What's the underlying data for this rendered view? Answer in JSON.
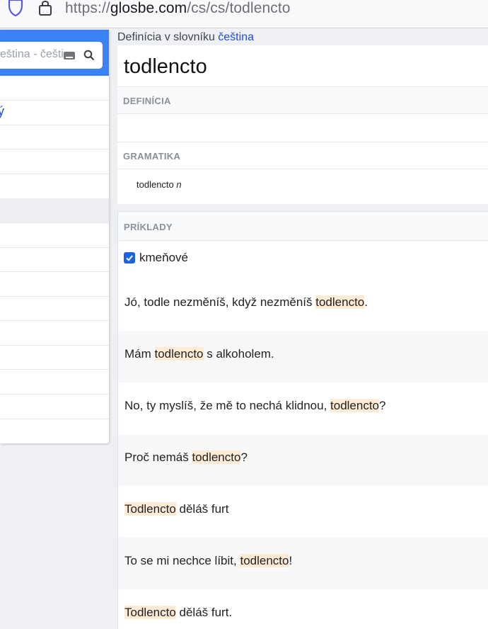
{
  "browser": {
    "url_prefix": "https://",
    "url_host": "glosbe.com",
    "url_path": "/cs/cs/todlencto"
  },
  "sidebar": {
    "search_placeholder": "eština - češti",
    "link_fragment": "ý"
  },
  "breadcrumb": {
    "prefix": "Definícia v slovníku ",
    "language": "čeština"
  },
  "entry": {
    "headword": "todlencto",
    "definition_header": "DEFINÍCIA",
    "grammar_header": "GRAMATIKA",
    "grammar_word": "todlencto",
    "grammar_tag": "n"
  },
  "examples": {
    "header": "PRÍKLADY",
    "stem_label": "kmeňové",
    "stem_checked": true,
    "items": [
      {
        "before": "Jó, todle nezměníš, když nezměníš ",
        "term": "todlencto",
        "after": "."
      },
      {
        "before": "Mám ",
        "term": "todlencto",
        "after": " s alkoholem."
      },
      {
        "before": "No, ty myslíš, že mě to nechá klidnou, ",
        "term": "todlencto",
        "after": "?"
      },
      {
        "before": "Proč nemáš ",
        "term": "todlencto",
        "after": "?"
      },
      {
        "before": "",
        "term": "Todlencto",
        "after": " děláš furt"
      },
      {
        "before": "To se mi nechce líbit, ",
        "term": "todlencto",
        "after": "!"
      },
      {
        "before": "",
        "term": "Todlencto",
        "after": " děláš furt."
      }
    ]
  },
  "colors": {
    "accent": "#3b82f6",
    "link": "#1d4ed8",
    "highlight": "#fdebd5",
    "checkbox": "#1b63e0"
  }
}
